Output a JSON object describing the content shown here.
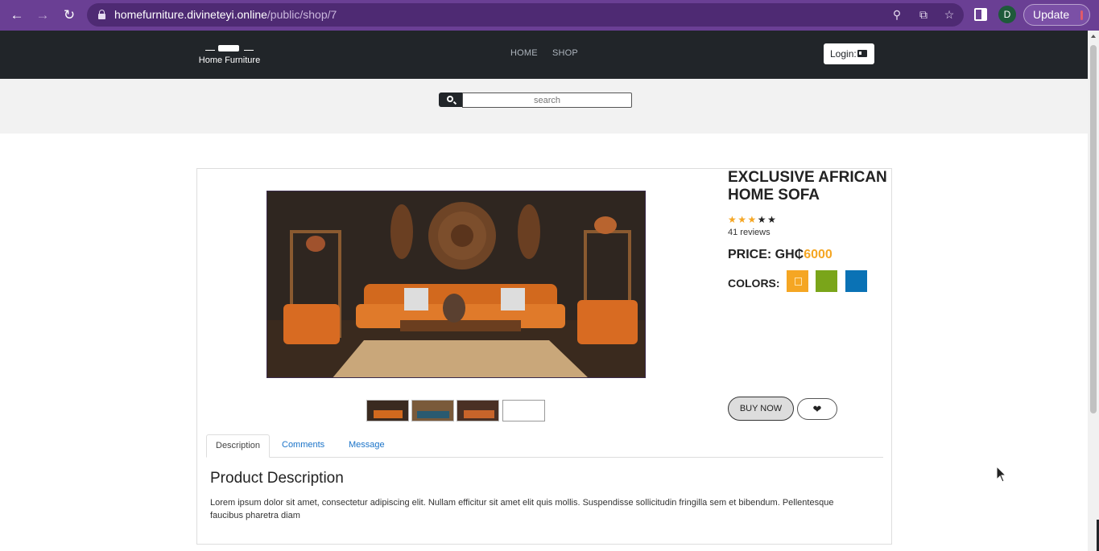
{
  "browser": {
    "url_host": "homefurniture.divineteyi.online",
    "url_path": "/public/shop/7",
    "profile_initial": "D",
    "update_label": "Update"
  },
  "site": {
    "logo_text": "Home Furniture",
    "nav": [
      "HOME",
      "SHOP"
    ],
    "login_label": "Login:"
  },
  "search": {
    "placeholder": "search"
  },
  "product": {
    "title": "EXCLUSIVE AFRICAN HOME SOFA",
    "rating": 3,
    "rating_max": 5,
    "reviews": "41 reviews",
    "price_label": "PRICE: GH₵",
    "price_value": "6000",
    "colors_label": "COLORS:",
    "colors": [
      "#f5a623",
      "#7aa51a",
      "#0a72b5"
    ],
    "buy_label": "BUY NOW"
  },
  "tabs": [
    "Description",
    "Comments",
    "Message"
  ],
  "description": {
    "title": "Product Description",
    "body": "Lorem ipsum dolor sit amet, consectetur adipiscing elit. Nullam efficitur sit amet elit quis mollis. Suspendisse sollicitudin fringilla sem et bibendum. Pellentesque faucibus pharetra diam"
  }
}
